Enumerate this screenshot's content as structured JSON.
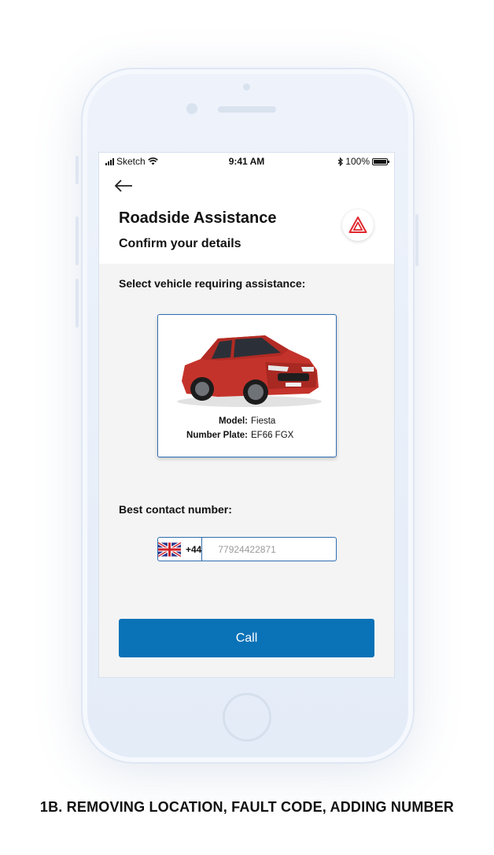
{
  "statusbar": {
    "carrier": "Sketch",
    "time": "9:41 AM",
    "battery": "100%"
  },
  "header": {
    "title": "Roadside Assistance",
    "subtitle": "Confirm your details"
  },
  "vehicle_section": {
    "label": "Select vehicle requiring assistance:",
    "vehicle": {
      "model_key": "Model:",
      "model": "Fiesta",
      "plate_key": "Number Plate:",
      "plate": "EF66 FGX"
    }
  },
  "contact_section": {
    "label": "Best contact number:",
    "country_code": "+44",
    "flag": "uk-flag-icon",
    "phone_placeholder": "77924422871"
  },
  "call_button": {
    "label": "Call"
  },
  "caption": "1B.  REMOVING LOCATION, FAULT CODE, ADDING NUMBER",
  "colors": {
    "accent": "#0a72b7",
    "hazard": "#e0282e",
    "car_red": "#c4332b"
  }
}
